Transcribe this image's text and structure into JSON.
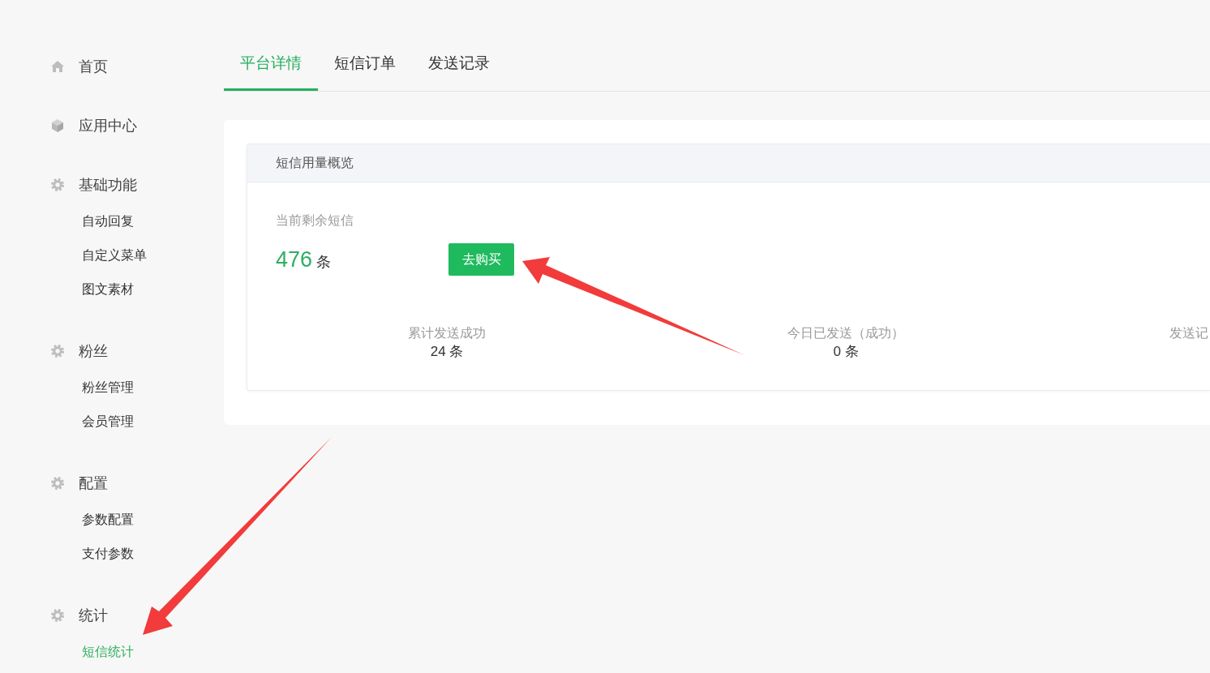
{
  "nav": [
    {
      "kind": "link",
      "label": "首页",
      "selected": false
    },
    {
      "kind": "link",
      "label": "应用中心",
      "selected": false
    },
    {
      "kind": "section",
      "label": "基础功能",
      "children": [
        {
          "label": "自动回复",
          "selected": false
        },
        {
          "label": "自定义菜单",
          "selected": false
        },
        {
          "label": "图文素材",
          "selected": false
        }
      ]
    },
    {
      "kind": "section",
      "label": "粉丝",
      "children": [
        {
          "label": "粉丝管理",
          "selected": false
        },
        {
          "label": "会员管理",
          "selected": false
        }
      ]
    },
    {
      "kind": "section",
      "label": "配置",
      "children": [
        {
          "label": "参数配置",
          "selected": false
        },
        {
          "label": "支付参数",
          "selected": false
        }
      ]
    },
    {
      "kind": "section",
      "label": "统计",
      "children": [
        {
          "label": "短信统计",
          "selected": true
        }
      ]
    }
  ],
  "tabs": [
    {
      "label": "平台详情",
      "selected": true
    },
    {
      "label": "短信订单",
      "selected": false
    },
    {
      "label": "发送记录",
      "selected": false
    }
  ],
  "overview": {
    "title": "短信用量概览",
    "remaining_label": "当前剩余短信",
    "remaining_count": "476",
    "remaining_unit": "条",
    "buy_button": "去购买",
    "stats": [
      {
        "label": "累计发送成功",
        "value": "24 条"
      },
      {
        "label": "今日已发送（成功）",
        "value": "0 条"
      },
      {
        "label": "发送记"
      }
    ]
  }
}
